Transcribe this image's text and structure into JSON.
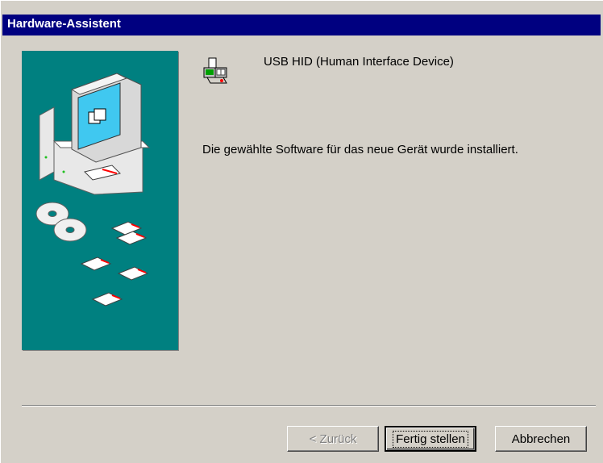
{
  "window": {
    "title": "Hardware-Assistent"
  },
  "device": {
    "icon": "usb-hid-device-icon",
    "name": "USB HID (Human Interface Device)"
  },
  "message": "Die gewählte Software für das neue Gerät wurde installiert.",
  "buttons": {
    "back": "< Zurück",
    "finish": "Fertig stellen",
    "cancel": "Abbrechen"
  },
  "colors": {
    "titlebar": "#000080",
    "illustration_bg": "#008080",
    "dialog_bg": "#d4d0c8"
  }
}
